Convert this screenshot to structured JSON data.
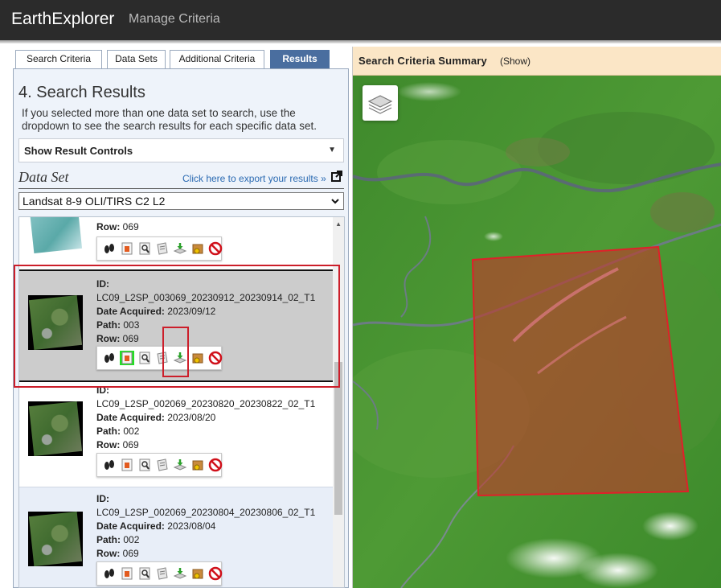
{
  "header": {
    "brand": "EarthExplorer",
    "nav_link": "Manage Criteria"
  },
  "tabs": [
    {
      "label": "Search Criteria",
      "active": false
    },
    {
      "label": "Data Sets",
      "active": false
    },
    {
      "label": "Additional Criteria",
      "active": false
    },
    {
      "label": "Results",
      "active": true
    }
  ],
  "results_panel": {
    "title": "4. Search Results",
    "description": "If you selected more than one data set to search, use the dropdown to see the search results for each specific data set.",
    "result_controls_label": "Show Result Controls",
    "dataset_heading": "Data Set",
    "export_link": "Click here to export your results »",
    "dataset_selected": "Landsat 8-9 OLI/TIRS C2 L2"
  },
  "labels": {
    "id": "ID:",
    "date": "Date Acquired:",
    "path": "Path:",
    "row": "Row:"
  },
  "results": [
    {
      "row": "069"
    },
    {
      "id": "LC09_L2SP_003069_20230912_20230914_02_T1",
      "date": "2023/09/12",
      "path": "003",
      "row": "069"
    },
    {
      "id": "LC09_L2SP_002069_20230820_20230822_02_T1",
      "date": "2023/08/20",
      "path": "002",
      "row": "069"
    },
    {
      "id": "LC09_L2SP_002069_20230804_20230806_02_T1",
      "date": "2023/08/04",
      "path": "002",
      "row": "069"
    }
  ],
  "tool_icons": [
    "footprint-icon",
    "overlay-icon",
    "compare-icon",
    "metadata-icon",
    "download-icon",
    "order-icon",
    "exclude-icon"
  ],
  "map": {
    "summary_title": "Search Criteria Summary",
    "show_link": "(Show)"
  },
  "colors": {
    "accent_tab": "#4a6e9f",
    "highlight": "#cc1e2a",
    "footprint_fill": "#c0392b",
    "active_tool": "#22e022"
  }
}
